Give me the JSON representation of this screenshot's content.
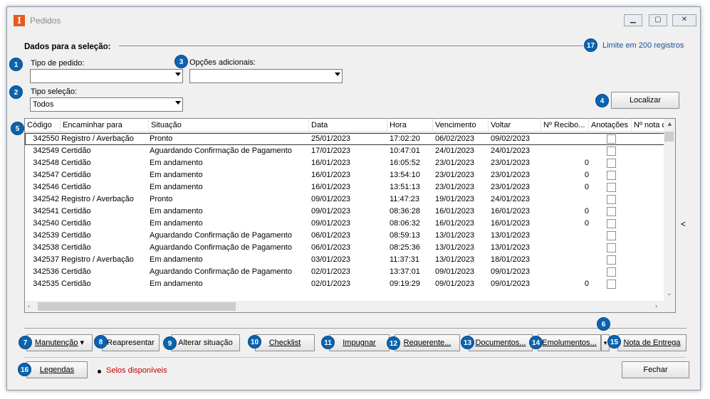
{
  "window": {
    "title": "Pedidos",
    "icon": "app-i-icon",
    "min": "▁",
    "max": "▢",
    "close": "✕"
  },
  "section": {
    "title": "Dados para a seleção:",
    "limit": "Limite em 200 registros"
  },
  "filters": {
    "tipo_pedido_label": "Tipo de pedido:",
    "tipo_pedido_value": "",
    "opcoes_label": "Opções adicionais:",
    "opcoes_value": "",
    "tipo_selecao_label": "Tipo seleção:",
    "tipo_selecao_value": "Todos"
  },
  "localizar": "Localizar",
  "badges": [
    "1",
    "2",
    "3",
    "4",
    "5",
    "6",
    "7",
    "8",
    "9",
    "10",
    "11",
    "12",
    "13",
    "14",
    "15",
    "16",
    "17"
  ],
  "grid": {
    "columns": [
      "Código",
      "Encaminhar para",
      "Situação",
      "Data",
      "Hora",
      "Vencimento",
      "Voltar",
      "Nº Recibo...",
      "Anotações",
      "Nº nota c"
    ],
    "rows": [
      [
        "342550",
        "Registro / Averbação",
        "Pronto",
        "25/01/2023",
        "17:02:20",
        "06/02/2023",
        "09/02/2023",
        ""
      ],
      [
        "342549",
        "Certidão",
        "Aguardando Confirmação de Pagamento",
        "17/01/2023",
        "10:47:01",
        "24/01/2023",
        "24/01/2023",
        ""
      ],
      [
        "342548",
        "Certidão",
        "Em andamento",
        "16/01/2023",
        "16:05:52",
        "23/01/2023",
        "23/01/2023",
        "0"
      ],
      [
        "342547",
        "Certidão",
        "Em andamento",
        "16/01/2023",
        "13:54:10",
        "23/01/2023",
        "23/01/2023",
        "0"
      ],
      [
        "342546",
        "Certidão",
        "Em andamento",
        "16/01/2023",
        "13:51:13",
        "23/01/2023",
        "23/01/2023",
        "0"
      ],
      [
        "342542",
        "Registro / Averbação",
        "Pronto",
        "09/01/2023",
        "11:47:23",
        "19/01/2023",
        "24/01/2023",
        ""
      ],
      [
        "342541",
        "Certidão",
        "Em andamento",
        "09/01/2023",
        "08:36:28",
        "16/01/2023",
        "16/01/2023",
        "0"
      ],
      [
        "342540",
        "Certidão",
        "Em andamento",
        "09/01/2023",
        "08:06:32",
        "16/01/2023",
        "16/01/2023",
        "0"
      ],
      [
        "342539",
        "Certidão",
        "Aguardando Confirmação de Pagamento",
        "06/01/2023",
        "08:59:13",
        "13/01/2023",
        "13/01/2023",
        ""
      ],
      [
        "342538",
        "Certidão",
        "Aguardando Confirmação de Pagamento",
        "06/01/2023",
        "08:25:36",
        "13/01/2023",
        "13/01/2023",
        ""
      ],
      [
        "342537",
        "Registro / Averbação",
        "Em andamento",
        "03/01/2023",
        "11:37:31",
        "13/01/2023",
        "18/01/2023",
        ""
      ],
      [
        "342536",
        "Certidão",
        "Aguardando Confirmação de Pagamento",
        "02/01/2023",
        "13:37:01",
        "09/01/2023",
        "09/01/2023",
        ""
      ],
      [
        "342535",
        "Certidão",
        "Em andamento",
        "02/01/2023",
        "09:19:29",
        "09/01/2023",
        "09/01/2023",
        "0"
      ]
    ]
  },
  "side_arrow": "<",
  "buttons": {
    "manutencao": "Manutenção",
    "reapresentar": "Reapresentar",
    "alterar": "Alterar situação",
    "checklist": "Checklist",
    "impugnar": "Impugnar",
    "requerente": "Requerente...",
    "documentos": "Documentos...",
    "emolumentos": "Emolumentos...",
    "nota_entrega": "Nota de Entrega",
    "legendas": "Legendas",
    "fechar": "Fechar"
  },
  "selos": "Selos disponíveis"
}
